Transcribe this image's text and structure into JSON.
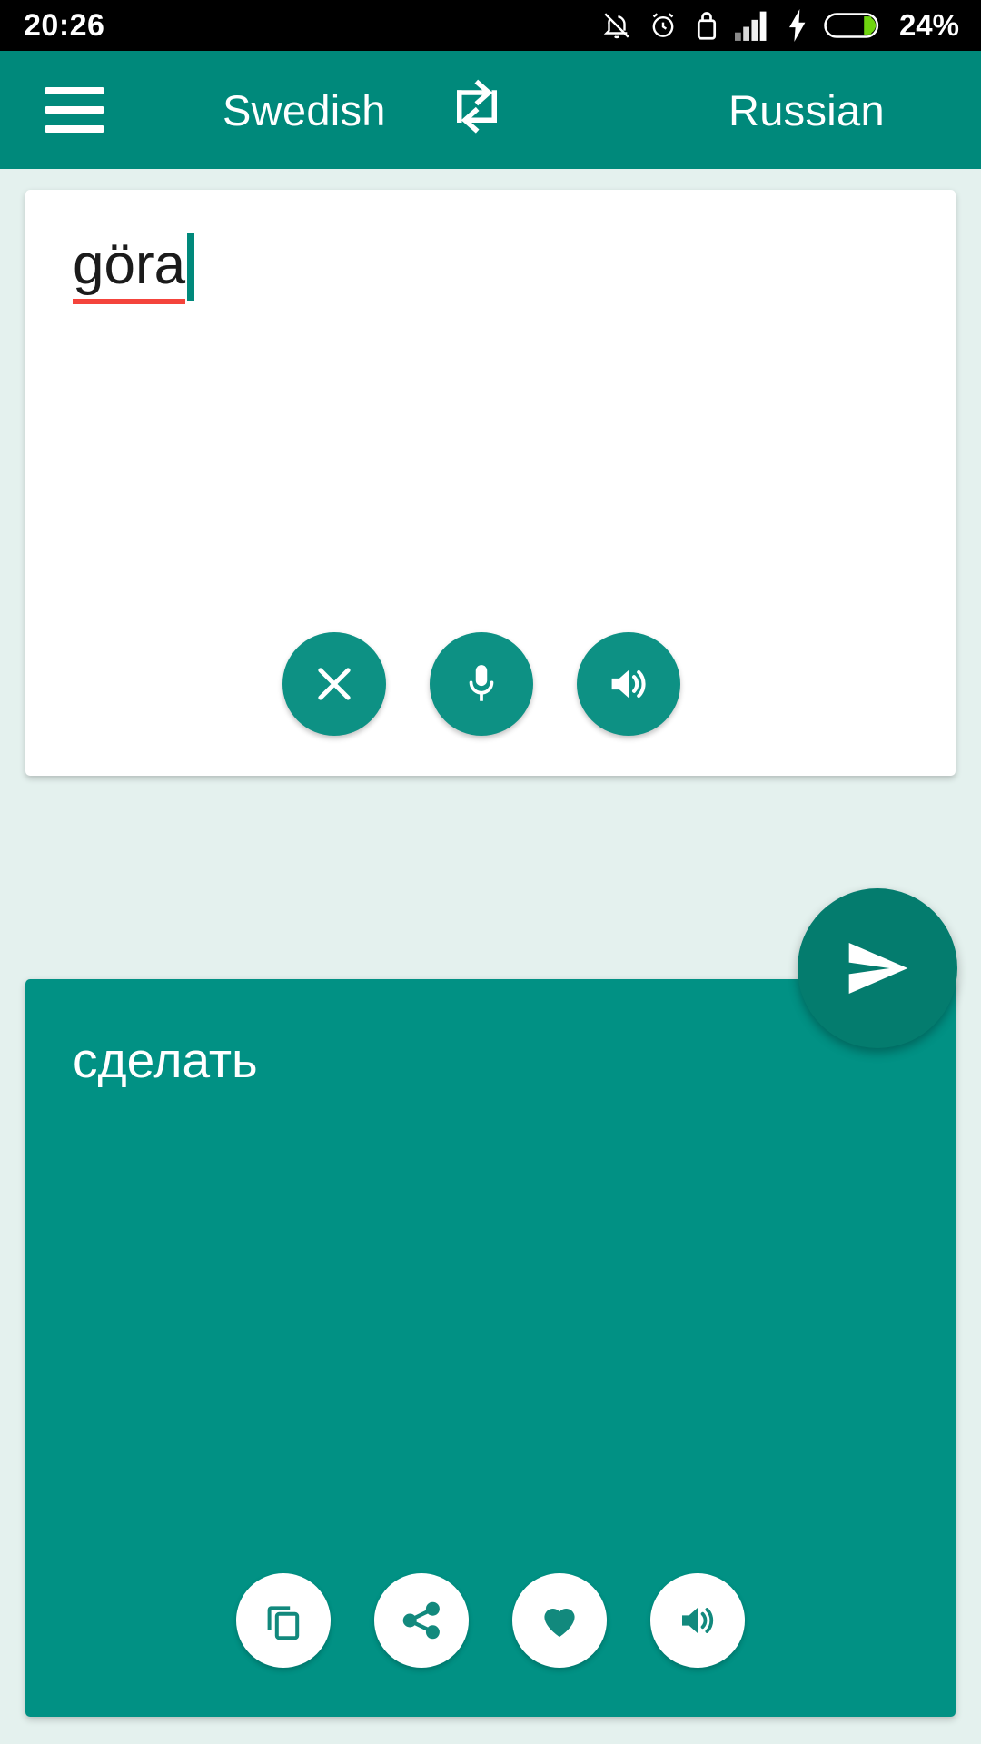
{
  "statusbar": {
    "time": "20:26",
    "battery_percent": "24%",
    "icons": [
      "bell-muted-icon",
      "alarm-clock-icon",
      "usb-lock-icon",
      "signal-bars-icon",
      "charging-bolt-icon",
      "battery-icon"
    ]
  },
  "appbar": {
    "menu_icon": "hamburger-menu-icon",
    "source_language": "Swedish",
    "swap_icon": "swap-languages-icon",
    "target_language": "Russian",
    "color": "#00897b"
  },
  "source": {
    "text": "göra",
    "placeholder": "",
    "spellcheck_underline_color": "#f4443c",
    "caret_color": "#00897b",
    "actions": [
      {
        "name": "clear-button",
        "icon": "close-x-icon",
        "label": "Clear"
      },
      {
        "name": "mic-button",
        "icon": "microphone-icon",
        "label": "Voice input"
      },
      {
        "name": "speak-source-button",
        "icon": "speaker-icon",
        "label": "Speak"
      }
    ]
  },
  "translate": {
    "name": "send-button",
    "icon": "send-arrow-icon",
    "label": "Translate",
    "color": "#047c6e"
  },
  "result": {
    "text": "сделать",
    "card_color": "#019184",
    "actions": [
      {
        "name": "copy-button",
        "icon": "copy-icon",
        "label": "Copy"
      },
      {
        "name": "share-button",
        "icon": "share-icon",
        "label": "Share"
      },
      {
        "name": "favorite-button",
        "icon": "heart-icon",
        "label": "Favorite"
      },
      {
        "name": "speak-result-button",
        "icon": "speaker-icon",
        "label": "Speak"
      }
    ]
  }
}
